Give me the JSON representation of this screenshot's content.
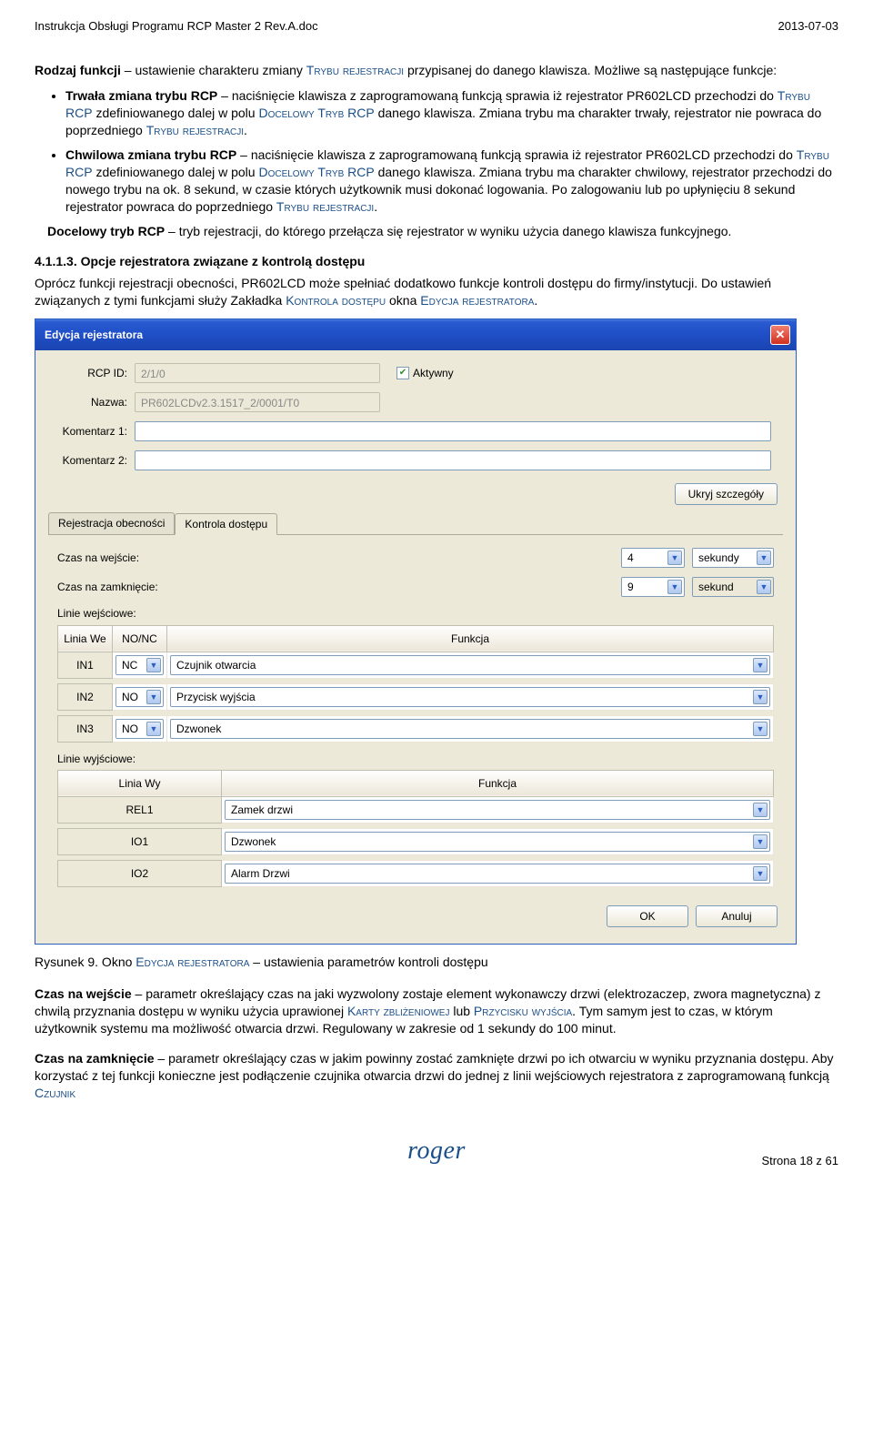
{
  "header": {
    "doc_title": "Instrukcja Obsługi Programu RCP Master 2 Rev.A.doc",
    "doc_date": "2013-07-03"
  },
  "text": {
    "p1a": "Rodzaj funkcji",
    "p1b": " – ustawienie charakteru zmiany ",
    "p1c": "Trybu rejestracji",
    "p1d": " przypisanej do danego klawisza. Możliwe są następujące funkcje:",
    "b1a": "Trwała zmiana trybu RCP",
    "b1b": " – naciśnięcie klawisza z zaprogramowaną funkcją sprawia iż rejestrator PR602LCD przechodzi do ",
    "b1c": "Trybu RCP",
    "b1d": " zdefiniowanego dalej w polu ",
    "b1e": "Docelowy Tryb RCP",
    "b1f": " danego klawisza. Zmiana trybu ma charakter trwały, rejestrator nie powraca do poprzedniego ",
    "b1g": "Trybu rejestracji",
    "b1h": ".",
    "b2a": "Chwilowa zmiana trybu RCP",
    "b2b": " – naciśnięcie klawisza z zaprogramowaną funkcją sprawia iż rejestrator PR602LCD przechodzi do ",
    "b2c": "Trybu RCP",
    "b2d": " zdefiniowanego dalej w polu ",
    "b2e": "Docelowy Tryb RCP",
    "b2f": " danego klawisza. Zmiana trybu ma charakter chwilowy, rejestrator przechodzi do nowego trybu na ok. 8 sekund, w czasie których użytkownik musi dokonać logowania. Po zalogowaniu lub po upłynięciu 8 sekund rejestrator powraca do poprzedniego ",
    "b2g": "Trybu rejestracji",
    "b2h": ".",
    "p2a": "Docelowy tryb RCP",
    "p2b": " – tryb rejestracji, do którego przełącza się rejestrator w wyniku użycia danego klawisza funkcyjnego.",
    "h2": "4.1.1.3. Opcje rejestratora związane z kontrolą dostępu",
    "p3a": "Oprócz funkcji rejestracji obecności, PR602LCD może spełniać dodatkowo funkcje kontroli dostępu do firmy/instytucji. Do ustawień związanych z tymi funkcjami służy Zakładka ",
    "p3b": "Kontrola dostępu",
    "p3c": " okna ",
    "p3d": "Edycja rejestratora",
    "p3e": ".",
    "caption_a": "Rysunek 9. Okno ",
    "caption_b": "Edycja rejestratora",
    "caption_c": " – ustawienia parametrów kontroli dostępu",
    "p4a": "Czas na wejście",
    "p4b": " – parametr określający czas na jaki wyzwolony zostaje element wykonawczy drzwi (elektrozaczep, zwora magnetyczna) z chwilą przyznania dostępu w wyniku użycia uprawionej ",
    "p4c": "Karty zbliżeniowej",
    "p4d": " lub ",
    "p4e": "Przycisku wyjścia",
    "p4f": ". Tym samym jest to czas, w którym użytkownik systemu ma możliwość otwarcia drzwi. Regulowany w zakresie od 1 sekundy do 100 minut.",
    "p5a": "Czas na zamknięcie",
    "p5b": " – parametr określający czas w jakim powinny zostać zamknięte drzwi po ich otwarciu w wyniku przyznania dostępu. Aby korzystać z tej funkcji konieczne jest podłączenie czujnika otwarcia drzwi do jednej z linii wejściowych rejestratora z zaprogramowaną funkcją ",
    "p5c": "Czujnik"
  },
  "win": {
    "title": "Edycja rejestratora",
    "labels": {
      "rcp_id": "RCP ID:",
      "nazwa": "Nazwa:",
      "k1": "Komentarz 1:",
      "k2": "Komentarz 2:",
      "aktywny": "Aktywny",
      "ukryj": "Ukryj szczegóły",
      "tab1": "Rejestracja obecności",
      "tab2": "Kontrola dostępu",
      "czas_we": "Czas na wejście:",
      "czas_zam": "Czas na zamknięcie:",
      "linie_we": "Linie wejściowe:",
      "col_linia_we": "Linia We",
      "col_nonc": "NO/NC",
      "col_funkcja": "Funkcja",
      "linie_wy": "Linie wyjściowe:",
      "col_linia_wy": "Linia Wy",
      "ok": "OK",
      "anuluj": "Anuluj"
    },
    "values": {
      "rcp_id": "2/1/0",
      "nazwa": "PR602LCDv2.3.1517_2/0001/T0",
      "czas_we_val": "4",
      "czas_we_unit": "sekundy",
      "czas_zam_val": "9",
      "czas_zam_unit": "sekund",
      "in": [
        {
          "id": "IN1",
          "nonc": "NC",
          "func": "Czujnik otwarcia"
        },
        {
          "id": "IN2",
          "nonc": "NO",
          "func": "Przycisk wyjścia"
        },
        {
          "id": "IN3",
          "nonc": "NO",
          "func": "Dzwonek"
        }
      ],
      "out": [
        {
          "id": "REL1",
          "func": "Zamek drzwi"
        },
        {
          "id": "IO1",
          "func": "Dzwonek"
        },
        {
          "id": "IO2",
          "func": "Alarm Drzwi"
        }
      ]
    }
  },
  "footer": {
    "roger": "roger",
    "page": "Strona 18 z 61"
  }
}
